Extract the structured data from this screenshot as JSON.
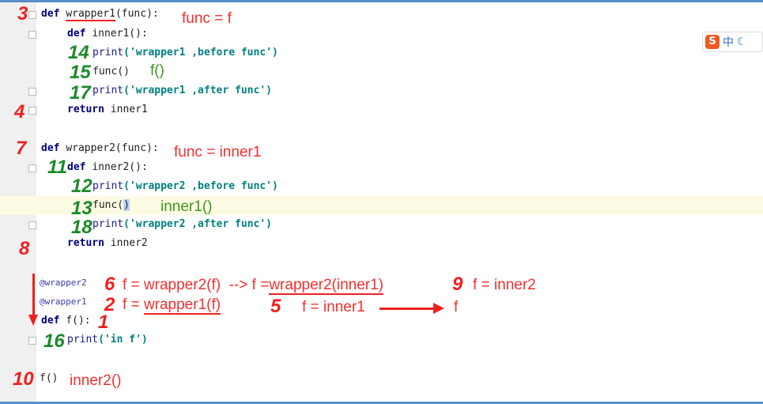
{
  "code": {
    "l1": {
      "kw": "def",
      "name": "wrapper1",
      "rest": "(func):"
    },
    "l2": {
      "kw": "def",
      "rest": "inner1():"
    },
    "l3": {
      "fn": "print",
      "str": "('wrapper1 ,before func')"
    },
    "l4": {
      "text": "func()"
    },
    "l5": {
      "fn": "print",
      "str": "('wrapper1 ,after func')"
    },
    "l6": {
      "kw": "return",
      "rest": "inner1"
    },
    "l7": {
      "kw": "def",
      "rest": "wrapper2(func):"
    },
    "l8": {
      "kw": "def",
      "rest": "inner2():"
    },
    "l9": {
      "fn": "print",
      "str": "('wrapper2 ,before func')"
    },
    "l10": {
      "a": "func(",
      ")": ")"
    },
    "l11": {
      "fn": "print",
      "str": "('wrapper2 ,after func')"
    },
    "l12": {
      "kw": "return",
      "rest": "inner2"
    },
    "l13": {
      "text": "@wrapper2"
    },
    "l14": {
      "text": "@wrapper1"
    },
    "l15": {
      "kw": "def",
      "rest": "f():"
    },
    "l16": {
      "fn": "print",
      "str": "('in f')"
    },
    "l17": {
      "text": "f()"
    }
  },
  "annotations": {
    "a1": "func = f",
    "a2": "f()",
    "a3": "func = inner1",
    "a4": "inner1()",
    "a5": "f = wrapper2(f)  --> f =",
    "a5u": "wrapper2(inner1)",
    "a6": "f = inner2",
    "a7": "f = ",
    "a7u": "wrapper1(f)",
    "a8": "f = inner1",
    "a9": "f",
    "a10": "inner2()"
  },
  "steps": {
    "s3": "3",
    "s14": "14",
    "s15": "15",
    "s17": "17",
    "s4": "4",
    "s7": "7",
    "s11": "11",
    "s12": "12",
    "s13": "13",
    "s18": "18",
    "s8": "8",
    "s6": "6",
    "s9": "9",
    "s2": "2",
    "s5": "5",
    "s1": "1",
    "s16": "16",
    "s10": "10"
  },
  "ime": {
    "logo": "S",
    "mode": "中",
    "moon": "☾"
  }
}
